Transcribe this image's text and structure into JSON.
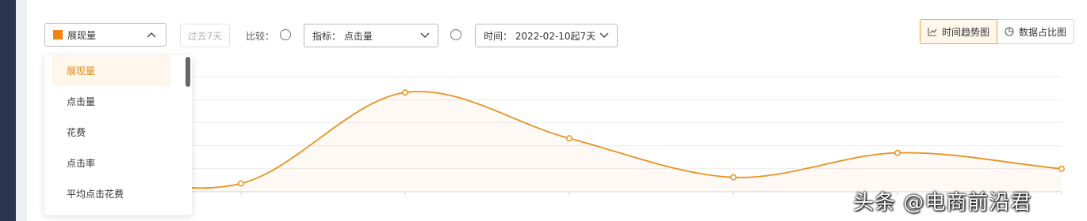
{
  "toolbar": {
    "metric_select": {
      "value": "展现量",
      "swatch_color": "#f5820e"
    },
    "past7": "过去7天",
    "compare_label": "比较：",
    "indicator_select": {
      "value": "指标： 点击量"
    },
    "time_select": {
      "value": "时间： 2022-02-10起7天"
    },
    "view_toggle": {
      "trend": "时间趋势图",
      "share": "数据占比图"
    }
  },
  "dropdown": {
    "items": [
      "展现量",
      "点击量",
      "花费",
      "点击率",
      "平均点击花费"
    ],
    "selected_index": 0
  },
  "chart_data": {
    "type": "area",
    "series": [
      {
        "values": [
          0.8,
          0.36,
          4.31,
          2.32,
          0.63,
          1.69,
          1.0
        ]
      }
    ],
    "ylim": [
      0,
      5
    ],
    "grid": true,
    "color": "#e8921f"
  },
  "watermark": "头条 @电商前沿君"
}
